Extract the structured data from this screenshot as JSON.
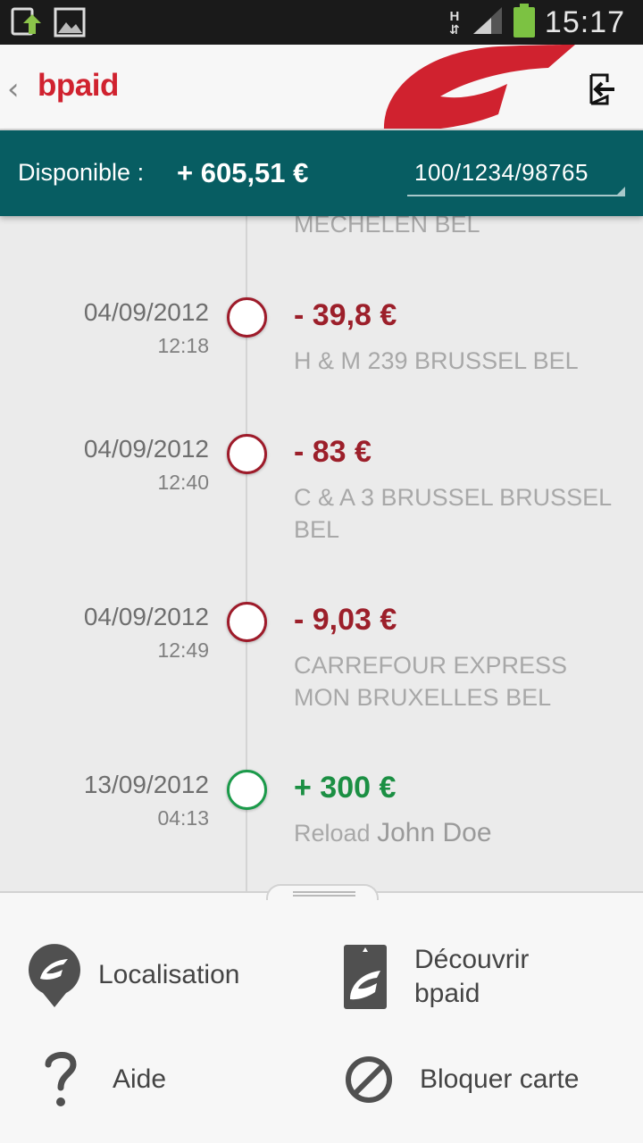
{
  "statusbar": {
    "time": "15:17",
    "network": "H",
    "icons": [
      "upload-notification-icon",
      "image-notification-icon",
      "data-transfer-icon",
      "signal-icon",
      "battery-icon"
    ]
  },
  "appbar": {
    "brand": "bpaid",
    "icons": [
      "back-chevron-icon",
      "bpost-logo",
      "logout-icon"
    ]
  },
  "balance": {
    "label": "Disponible :",
    "amount": "+ 605,51 €",
    "account": "100/1234/98765"
  },
  "timeline": {
    "partial_merchant": "MECHELEN BEL",
    "transactions": [
      {
        "date": "04/09/2012",
        "time": "12:18",
        "amount": "- 39,8 €",
        "merchant": "H & M 239 BRUSSEL BEL",
        "type": "debit"
      },
      {
        "date": "04/09/2012",
        "time": "12:40",
        "amount": "- 83 €",
        "merchant": "C & A 3 BRUSSEL BRUSSEL BEL",
        "type": "debit"
      },
      {
        "date": "04/09/2012",
        "time": "12:49",
        "amount": "- 9,03 €",
        "merchant": "CARREFOUR EXPRESS MON BRUXELLES BEL",
        "type": "debit"
      },
      {
        "date": "13/09/2012",
        "time": "04:13",
        "amount": "+ 300 €",
        "merchant": "Reload",
        "merchant_name": "John Doe",
        "type": "credit"
      }
    ]
  },
  "drawer": {
    "items": [
      {
        "label": "Localisation",
        "icon": "location-pin-icon"
      },
      {
        "label": "Découvrir bpaid",
        "icon": "card-icon"
      },
      {
        "label": "Aide",
        "icon": "question-icon"
      },
      {
        "label": "Bloquer carte",
        "icon": "block-icon"
      }
    ]
  },
  "colors": {
    "brand_red": "#d0222f",
    "debit": "#9c1f2a",
    "credit": "#1b8f43",
    "balance_bar": "#075d62"
  }
}
